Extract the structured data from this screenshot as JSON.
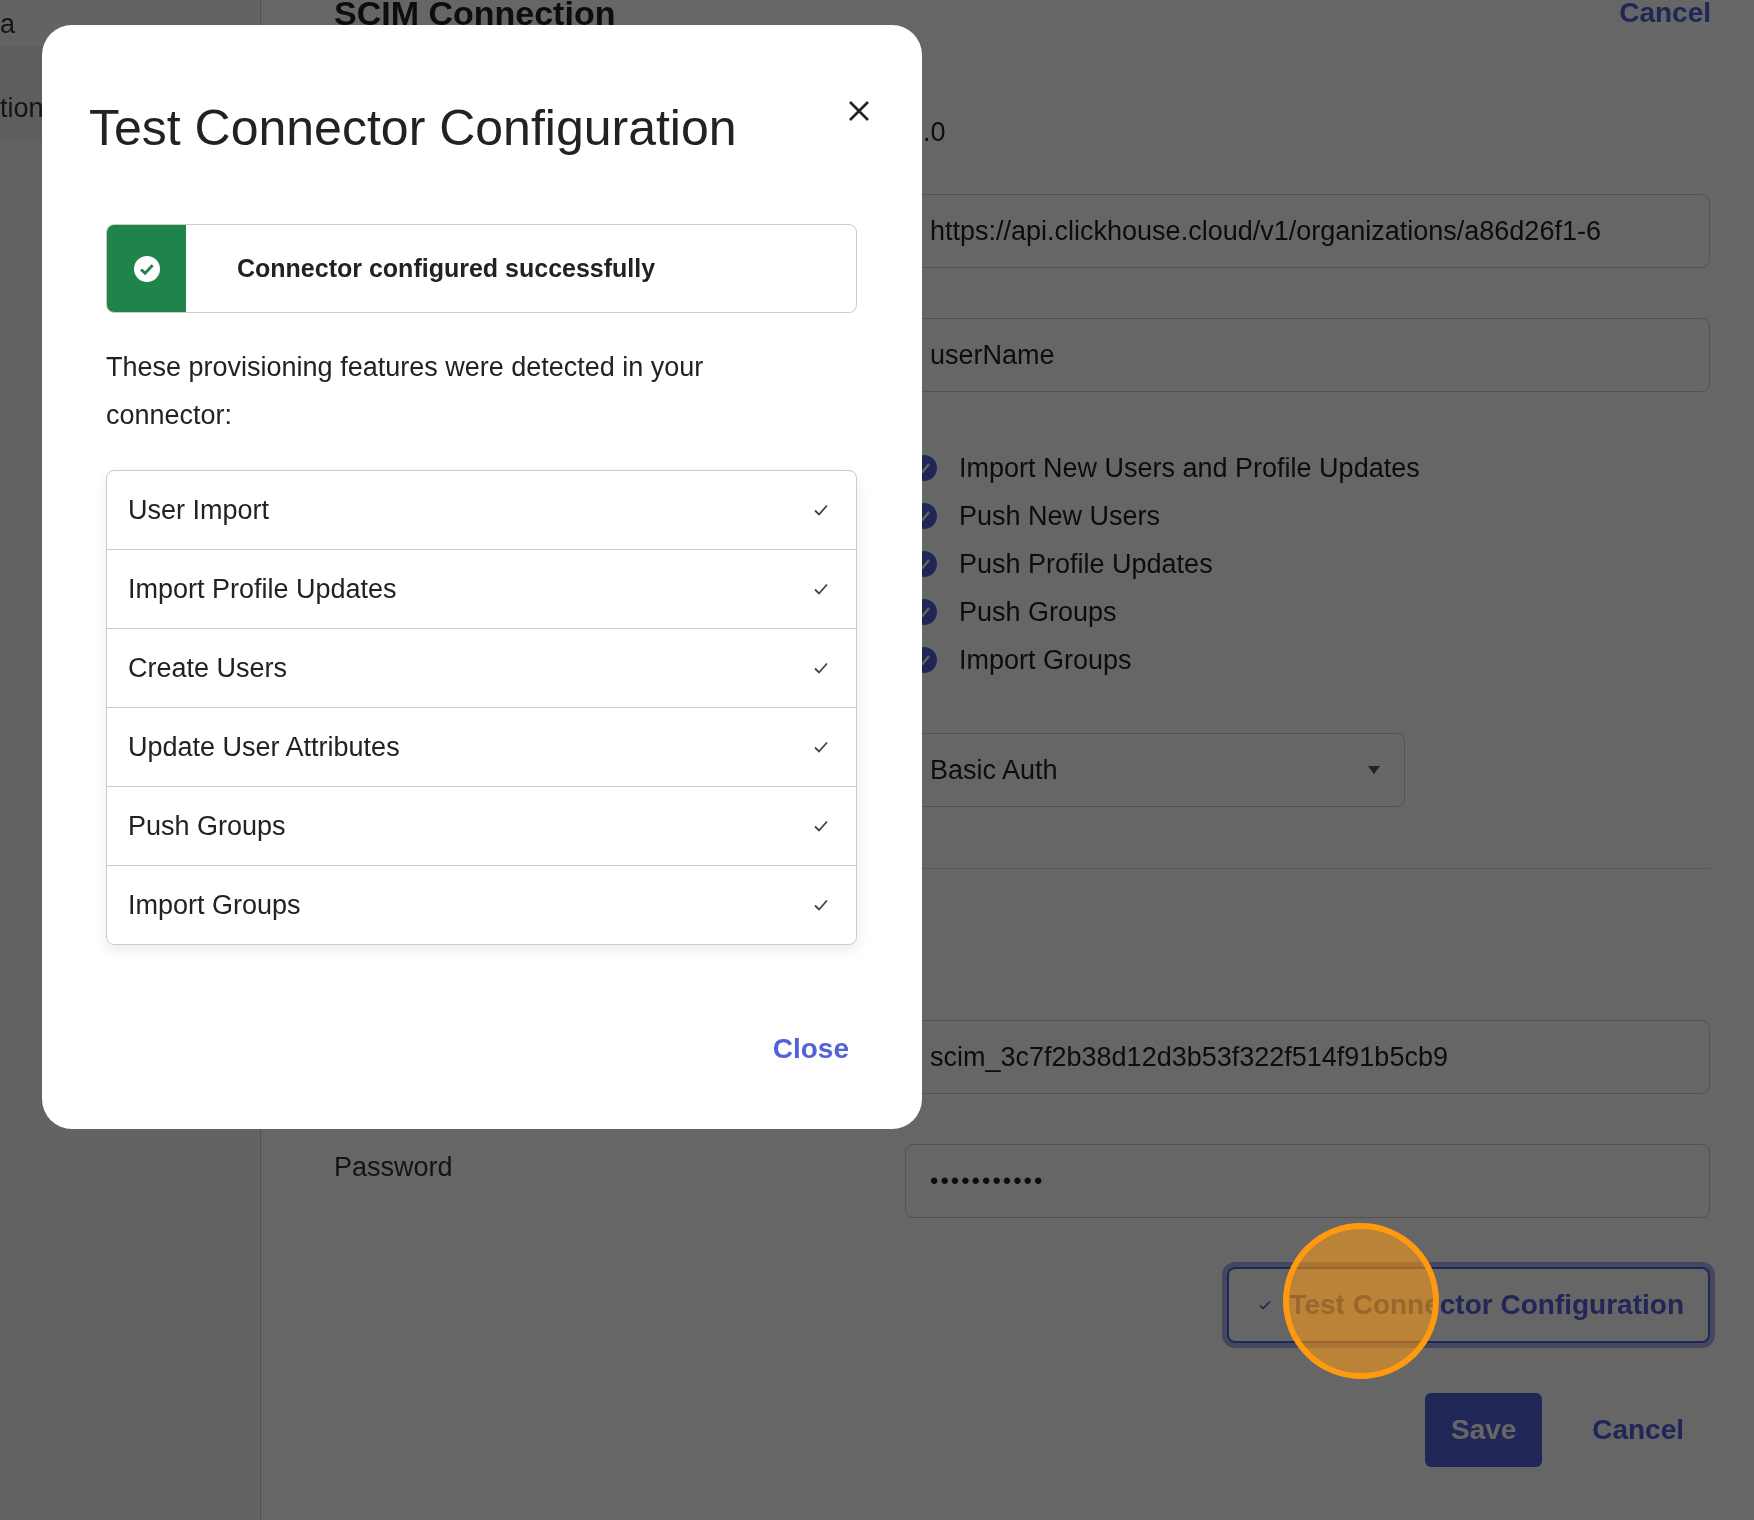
{
  "sidebar": {
    "items": [
      {
        "label": "a",
        "selected": false
      },
      {
        "label": "tion",
        "selected": true
      }
    ]
  },
  "page": {
    "title": "SCIM Connection",
    "header_cancel": "Cancel",
    "version_fragment": ".0",
    "base_url": "https://api.clickhouse.cloud/v1/organizations/a86d26f1-6",
    "unique_identifier": "userName",
    "actions": [
      {
        "label": "Import New Users and Profile Updates",
        "checked": true
      },
      {
        "label": "Push New Users",
        "checked": true
      },
      {
        "label": "Push Profile Updates",
        "checked": true
      },
      {
        "label": "Push Groups",
        "checked": true
      },
      {
        "label": "Import Groups",
        "checked": true
      }
    ],
    "auth_mode": "Basic Auth",
    "username": "scim_3c7f2b38d12d3b53f322f514f91b5cb9",
    "password_label": "Password",
    "password": "•••••••••••",
    "test_button": "Test Connector Configuration",
    "save_button": "Save",
    "cancel_button": "Cancel"
  },
  "modal": {
    "title": "Test Connector Configuration",
    "alert": "Connector configured successfully",
    "description": "These provisioning features were detected in your connector:",
    "features": [
      {
        "label": "User Import",
        "detected": true
      },
      {
        "label": "Import Profile Updates",
        "detected": true
      },
      {
        "label": "Create Users",
        "detected": true
      },
      {
        "label": "Update User Attributes",
        "detected": true
      },
      {
        "label": "Push Groups",
        "detected": true
      },
      {
        "label": "Import Groups",
        "detected": true
      }
    ],
    "close_button": "Close"
  }
}
